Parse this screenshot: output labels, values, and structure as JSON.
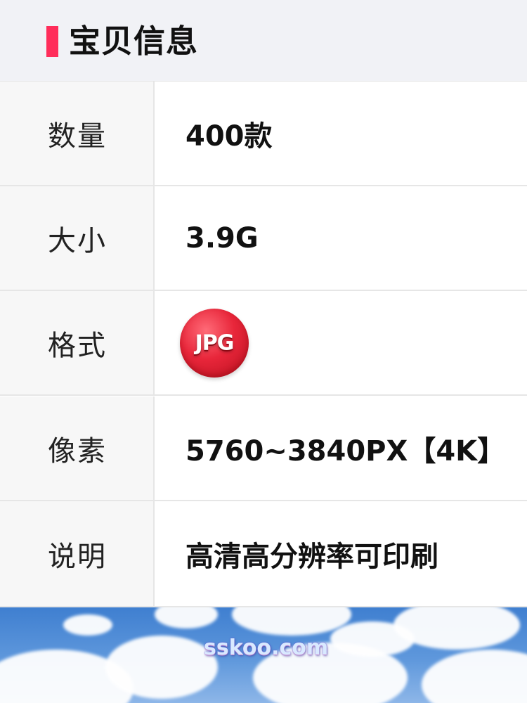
{
  "header": {
    "title": "宝贝信息",
    "accent_color": "#ff2d5a"
  },
  "rows": [
    {
      "label": "数量",
      "value": "400款"
    },
    {
      "label": "大小",
      "value": "3.9G"
    },
    {
      "label": "格式",
      "badge_text": "JPG",
      "badge_color": "#e8263a"
    },
    {
      "label": "像素",
      "value": "5760~3840PX【4K】"
    },
    {
      "label": "说明",
      "value": "高清高分辨率可印刷"
    }
  ],
  "footer": {
    "watermark": "sskoo.com"
  }
}
